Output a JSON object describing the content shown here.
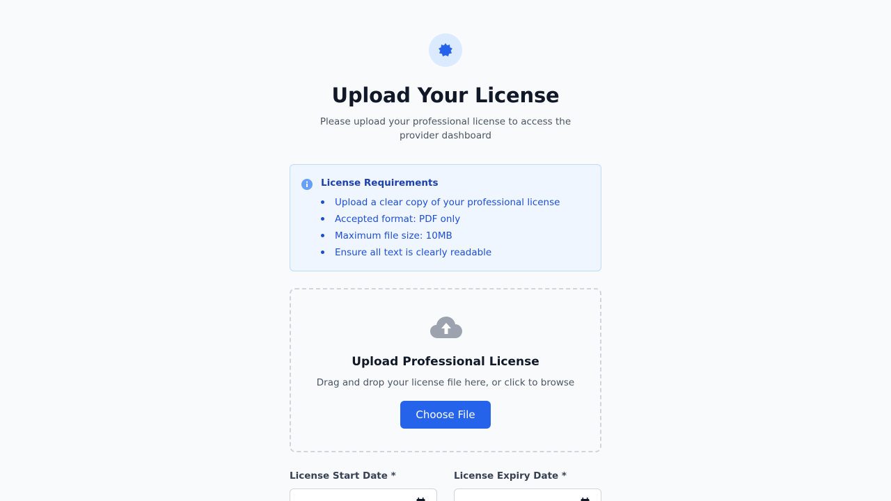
{
  "header": {
    "title": "Upload Your License",
    "subtitle": "Please upload your professional license to access the provider dashboard"
  },
  "requirements": {
    "title": "License Requirements",
    "items": [
      "Upload a clear copy of your professional license",
      "Accepted format: PDF only",
      "Maximum file size: 10MB",
      "Ensure all text is clearly readable"
    ]
  },
  "upload": {
    "title": "Upload Professional License",
    "subtitle": "Drag and drop your license file here, or click to browse",
    "button_label": "Choose File"
  },
  "dates": {
    "start_label": "License Start Date *",
    "expiry_label": "License Expiry Date *"
  },
  "colors": {
    "accent": "#2563eb",
    "badge_bg": "#dbeafe",
    "info_bg": "#eff6ff",
    "info_border": "#bfdbfe",
    "info_text": "#1d4ed8"
  }
}
